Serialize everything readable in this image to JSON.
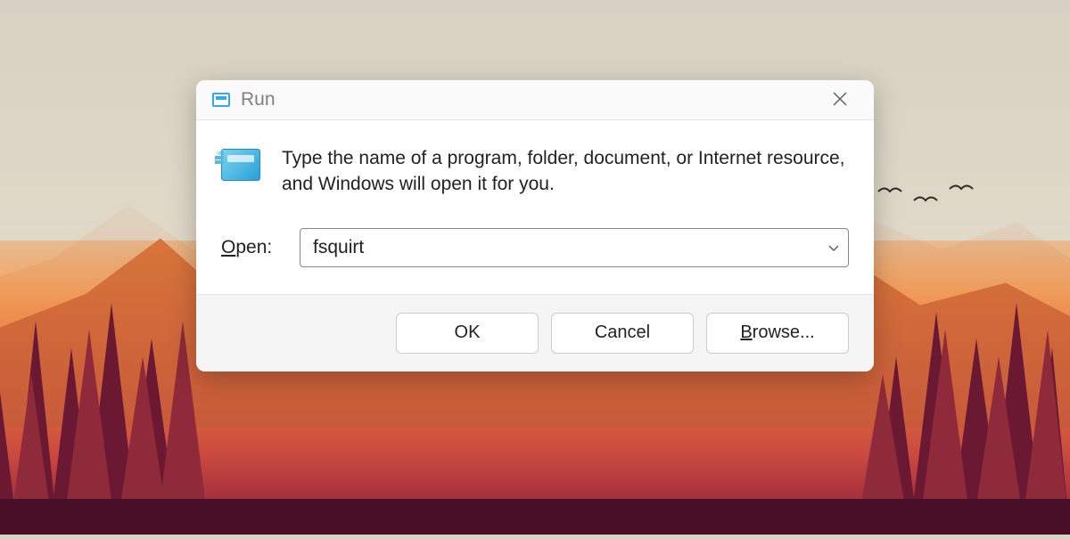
{
  "dialog": {
    "title": "Run",
    "description": "Type the name of a program, folder, document, or Internet resource, and Windows will open it for you.",
    "open_label_prefix": "O",
    "open_label_rest": "pen:",
    "input_value": "fsquirt",
    "buttons": {
      "ok": "OK",
      "cancel": "Cancel",
      "browse_prefix": "B",
      "browse_rest": "rowse..."
    }
  }
}
